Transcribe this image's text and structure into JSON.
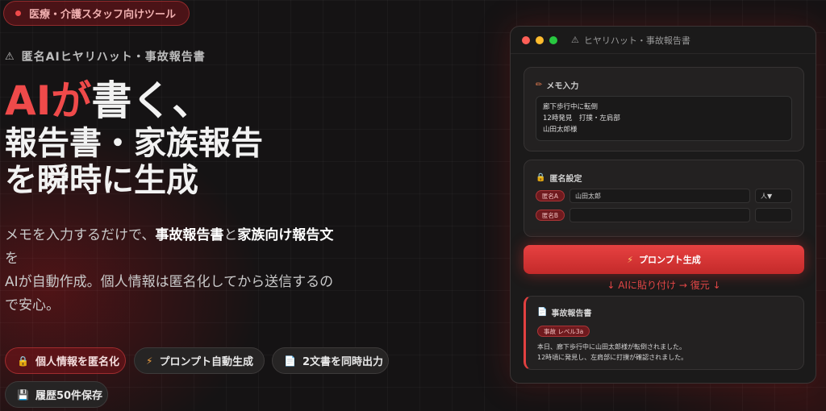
{
  "hero": {
    "badge": "医療・介護スタッフ向けツール",
    "eyebrow": "匿名AIヒヤリハット・事故報告書",
    "title_red": "AIが",
    "title_white": "書く、",
    "title_line2": "報告書・家族報告",
    "title_line3": "を瞬時に生成",
    "desc_1": "メモを入力するだけで、",
    "desc_b1": "事故報告書",
    "desc_2": "と",
    "desc_b2": "家族向け報告文",
    "desc_3": "を",
    "desc_4": "AIが自動作成。個人情報は匿名化してから送信するので安心。"
  },
  "chips": [
    {
      "icon": "lock-icon",
      "label": "個人情報を匿名化"
    },
    {
      "icon": "lightning-icon",
      "label": "プロンプト自動生成"
    },
    {
      "icon": "document-icon",
      "label": "2文書を同時出力"
    },
    {
      "icon": "floppy-disk-icon",
      "label": "履歴50件保存"
    }
  ],
  "window": {
    "title": "ヒヤリハット・事故報告書",
    "memo": {
      "header": "メモ入力",
      "lines": [
        "廊下歩行中に転倒",
        "12時発見　打撲・左肩部",
        "山田太郎様"
      ]
    },
    "anon": {
      "header": "匿名設定",
      "rows": [
        {
          "tag": "匿名A",
          "value": "山田太郎",
          "type": "人▼"
        },
        {
          "tag": "匿名B",
          "value": "",
          "type": ""
        }
      ]
    },
    "generate_label": "プロンプト生成",
    "flow_text": "↓ AIに貼り付け → 復元 ↓",
    "report": {
      "header": "事故報告書",
      "level": "事故 レベル3a",
      "lines": [
        "本日、廊下歩行中に山田太郎様が転倒されました。",
        "12時頃に発見し、左肩部に打撲が確認されました。"
      ]
    }
  },
  "colors": {
    "accent": "#ef4a4a",
    "background": "#151314",
    "window": "#1b1a1a"
  }
}
